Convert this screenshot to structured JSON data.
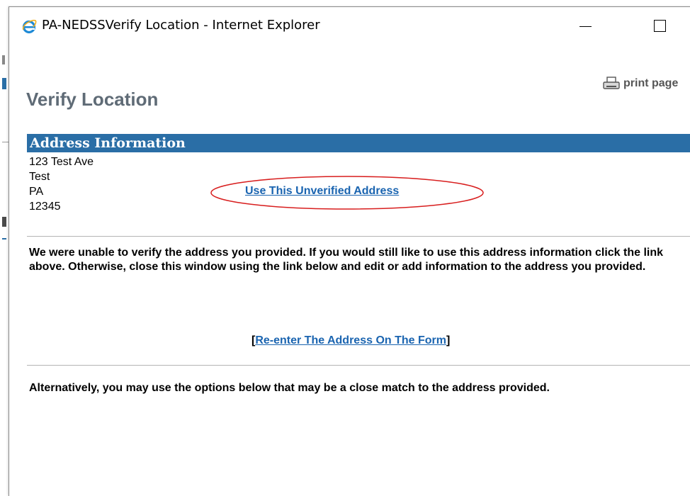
{
  "window": {
    "title": "PA-NEDSSVerify Location - Internet Explorer"
  },
  "toolbar": {
    "print_label": "print page"
  },
  "page": {
    "title": "Verify Location"
  },
  "address_section": {
    "header": "Address Information",
    "lines": [
      "123 Test Ave",
      "Test",
      "PA",
      "12345"
    ],
    "use_unverified_label": "Use This Unverified Address"
  },
  "messages": {
    "unable_to_verify": "We were unable to verify the address you provided.  If you would still like to use this address information  click the link above. Otherwise, close this window using the  link below and edit or add information to the address you provided.",
    "reenter_open": "[",
    "reenter_label": "Re-enter The Address On The Form",
    "reenter_close": "]",
    "alternatives": "Alternatively, you may use the options below that may be a close match to the address provided."
  },
  "icons": {
    "browser": "internet-explorer-icon",
    "print": "printer-icon"
  },
  "colors": {
    "header_bg": "#2a6ea6",
    "link": "#1a64b0",
    "title": "#5f6b76",
    "annotation": "#d81e1e"
  }
}
